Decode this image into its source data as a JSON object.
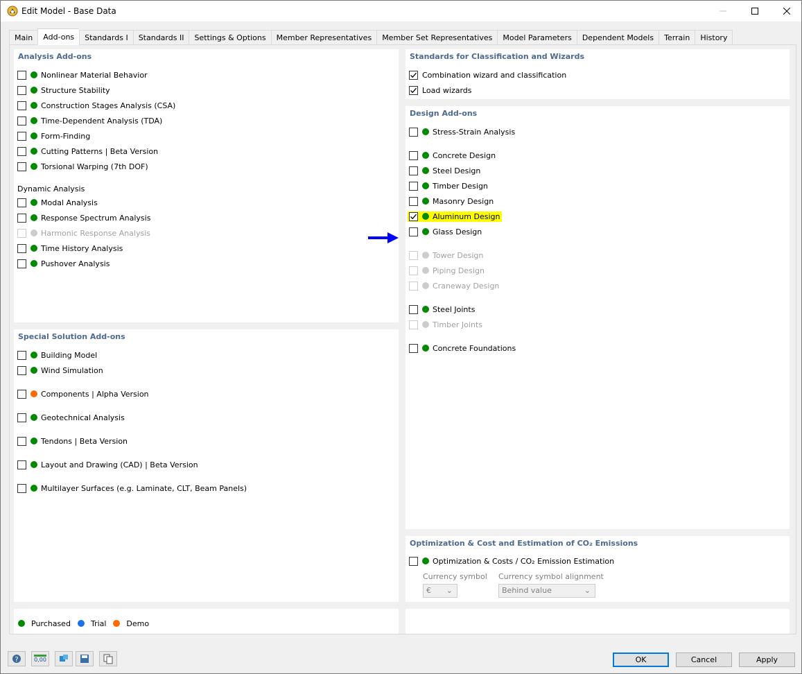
{
  "window": {
    "title": "Edit Model - Base Data"
  },
  "tabs": [
    "Main",
    "Add-ons",
    "Standards I",
    "Standards II",
    "Settings & Options",
    "Member Representatives",
    "Member Set Representatives",
    "Model Parameters",
    "Dependent Models",
    "Terrain",
    "History"
  ],
  "active_tab": "Add-ons",
  "colors": {
    "purchased": "#008a00",
    "trial": "#1a73e8",
    "demo": "#ff6a00",
    "disabled": "#cccccc",
    "section_title": "#4c6a8f",
    "highlight": "#ffff00",
    "arrow": "#0000ff"
  },
  "analysis": {
    "title": "Analysis Add-ons",
    "items": [
      {
        "label": "Nonlinear Material Behavior",
        "checked": false,
        "status": "purchased"
      },
      {
        "label": "Structure Stability",
        "checked": false,
        "status": "purchased"
      },
      {
        "label": "Construction Stages Analysis (CSA)",
        "checked": false,
        "status": "purchased"
      },
      {
        "label": "Time-Dependent Analysis (TDA)",
        "checked": false,
        "status": "purchased"
      },
      {
        "label": "Form-Finding",
        "checked": false,
        "status": "purchased"
      },
      {
        "label": "Cutting Patterns | Beta Version",
        "checked": false,
        "status": "purchased"
      },
      {
        "label": "Torsional Warping (7th DOF)",
        "checked": false,
        "status": "purchased"
      }
    ],
    "dynamic_heading": "Dynamic Analysis",
    "dynamic_items": [
      {
        "label": "Modal Analysis",
        "checked": false,
        "status": "purchased"
      },
      {
        "label": "Response Spectrum Analysis",
        "checked": false,
        "status": "purchased"
      },
      {
        "label": "Harmonic Response Analysis",
        "checked": false,
        "status": "disabled"
      },
      {
        "label": "Time History Analysis",
        "checked": false,
        "status": "purchased"
      },
      {
        "label": "Pushover Analysis",
        "checked": false,
        "status": "purchased"
      }
    ]
  },
  "special": {
    "title": "Special Solution Add-ons",
    "items": [
      {
        "label": "Building Model",
        "checked": false,
        "status": "purchased"
      },
      {
        "label": "Wind Simulation",
        "checked": false,
        "status": "purchased"
      },
      {
        "label": "Components | Alpha Version",
        "checked": false,
        "status": "demo"
      },
      {
        "label": "Geotechnical Analysis",
        "checked": false,
        "status": "purchased"
      },
      {
        "label": "Tendons | Beta Version",
        "checked": false,
        "status": "purchased"
      },
      {
        "label": "Layout and Drawing (CAD) | Beta Version",
        "checked": false,
        "status": "purchased"
      },
      {
        "label": "Multilayer Surfaces (e.g. Laminate, CLT, Beam Panels)",
        "checked": false,
        "status": "purchased"
      }
    ]
  },
  "legend": {
    "purchased": "Purchased",
    "trial": "Trial",
    "demo": "Demo"
  },
  "standards": {
    "title": "Standards for Classification and Wizards",
    "items": [
      {
        "label": "Combination wizard and classification",
        "checked": true
      },
      {
        "label": "Load wizards",
        "checked": true
      }
    ]
  },
  "design": {
    "title": "Design Add-ons",
    "items": [
      {
        "label": "Stress-Strain Analysis",
        "checked": false,
        "status": "purchased"
      },
      {
        "label": "Concrete Design",
        "checked": false,
        "status": "purchased"
      },
      {
        "label": "Steel Design",
        "checked": false,
        "status": "purchased"
      },
      {
        "label": "Timber Design",
        "checked": false,
        "status": "purchased"
      },
      {
        "label": "Masonry Design",
        "checked": false,
        "status": "purchased"
      },
      {
        "label": "Aluminum Design",
        "checked": true,
        "status": "purchased",
        "highlighted": true
      },
      {
        "label": "Glass Design",
        "checked": false,
        "status": "purchased"
      },
      {
        "label": "Tower Design",
        "checked": false,
        "status": "disabled"
      },
      {
        "label": "Piping Design",
        "checked": false,
        "status": "disabled"
      },
      {
        "label": "Craneway Design",
        "checked": false,
        "status": "disabled"
      },
      {
        "label": "Steel Joints",
        "checked": false,
        "status": "purchased"
      },
      {
        "label": "Timber Joints",
        "checked": false,
        "status": "disabled"
      },
      {
        "label": "Concrete Foundations",
        "checked": false,
        "status": "purchased"
      }
    ]
  },
  "optimization": {
    "title": "Optimization & Cost and Estimation of CO₂ Emissions",
    "item": {
      "label": "Optimization & Costs / CO₂ Emission Estimation",
      "checked": false,
      "status": "purchased"
    },
    "currency_symbol_label": "Currency symbol",
    "currency_symbol_value": "€",
    "alignment_label": "Currency symbol alignment",
    "alignment_value": "Behind value"
  },
  "toolbar_icons": [
    "help-icon",
    "units-icon",
    "transfer-icon",
    "save-settings-icon",
    "copy-icon"
  ],
  "units_icon_text": "0,00",
  "buttons": {
    "ok": "OK",
    "cancel": "Cancel",
    "apply": "Apply"
  }
}
